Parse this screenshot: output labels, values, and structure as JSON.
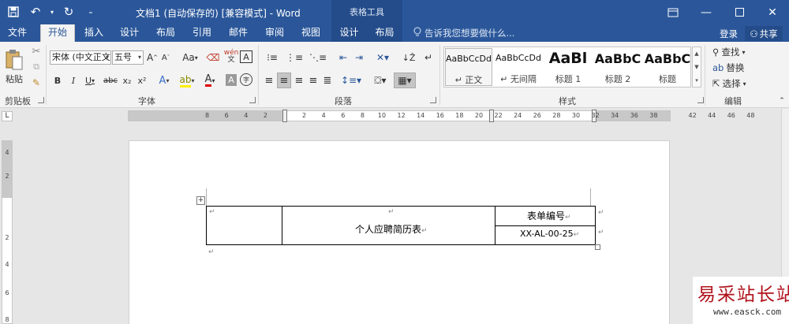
{
  "titlebar": {
    "doc_title": "文档1 (自动保存的) [兼容模式] - Word",
    "context_band": "表格工具",
    "qat_icons": [
      "save-icon",
      "undo-icon",
      "redo-icon",
      "customize-icon"
    ],
    "window_controls": [
      "ribbon-display-icon",
      "minimize-icon",
      "maximize-icon",
      "close-icon"
    ]
  },
  "tabs": {
    "file": "文件",
    "home": "开始",
    "insert": "插入",
    "design": "设计",
    "layout": "布局",
    "references": "引用",
    "mailings": "邮件",
    "review": "审阅",
    "view": "视图",
    "table_design": "设计",
    "table_layout": "布局",
    "tell_me": "告诉我您想要做什么...",
    "login": "登录",
    "share": "共享"
  },
  "ribbon": {
    "clipboard": {
      "label": "剪贴板",
      "paste": "粘贴"
    },
    "font": {
      "label": "字体",
      "font_name": "宋体 (中文正文",
      "font_size": "五号",
      "grow": "A",
      "shrink": "A",
      "change_case": "Aa",
      "pinyin": "wén",
      "char_border": "A",
      "bold": "B",
      "italic": "I",
      "underline": "U",
      "strikethrough": "abc",
      "subscript": "x₂",
      "superscript": "x²",
      "text_effects": "A",
      "font_color": "A",
      "char_shading": "A",
      "enclose": "字"
    },
    "paragraph": {
      "label": "段落"
    },
    "styles": {
      "label": "样式",
      "items": [
        {
          "preview": "AaBbCcDd",
          "name": "正文"
        },
        {
          "preview": "AaBbCcDd",
          "name": "无间隔"
        },
        {
          "preview": "AaBl",
          "name": "标题 1"
        },
        {
          "preview": "AaBbC",
          "name": "标题 2"
        },
        {
          "preview": "AaBbC",
          "name": "标题"
        }
      ]
    },
    "editing": {
      "label": "编辑",
      "find": "查找",
      "replace": "替换",
      "select": "选择"
    }
  },
  "ruler": {
    "corner": "L",
    "left_margin_ticks": [
      "8",
      "6",
      "4",
      "2"
    ],
    "body_ticks": [
      "2",
      "4",
      "6",
      "8",
      "10",
      "12",
      "14",
      "16",
      "18",
      "20",
      "22",
      "24",
      "26",
      "28",
      "30",
      "32",
      "34",
      "36",
      "38"
    ],
    "right_margin_ticks": [
      "42",
      "44",
      "46",
      "48"
    ],
    "vertical_ticks": [
      "4",
      "2",
      "2",
      "4",
      "6",
      "8"
    ]
  },
  "document": {
    "table": {
      "title": "个人应聘简历表",
      "form_no_label": "表单编号",
      "form_no_value": "XX-AL-00-25"
    }
  },
  "watermark": {
    "text_cn": "易采站长站",
    "url": "www.easck.com"
  }
}
